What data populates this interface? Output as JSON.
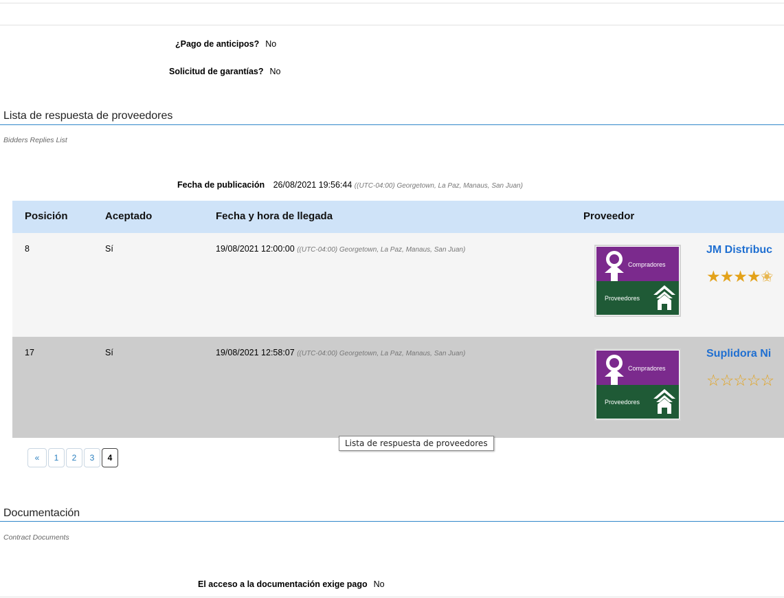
{
  "fields": {
    "advance_payment": {
      "label": "¿Pago de anticipos?",
      "value": "No"
    },
    "guarantees": {
      "label": "Solicitud de garantías?",
      "value": "No"
    }
  },
  "bidders_section": {
    "title": "Lista de respuesta de proveedores",
    "subtitle": "Bidders Replies List",
    "publication": {
      "label": "Fecha de publicación",
      "value": "26/08/2021 19:56:44",
      "timezone": "((UTC-04:00) Georgetown, La Paz, Manaus, San Juan)"
    },
    "table": {
      "headers": [
        "Posición",
        "Aceptado",
        "Fecha y hora de llegada",
        "Proveedor"
      ],
      "rows": [
        {
          "position": "8",
          "accepted": "Sí",
          "arrival": "19/08/2021 12:00:00",
          "timezone": "((UTC-04:00) Georgetown, La Paz, Manaus, San Juan)",
          "logo_top": "Compradores",
          "logo_bottom": "Proveedores",
          "vendor": "JM Distribuc",
          "rating_stars": "4.5 of 5"
        },
        {
          "position": "17",
          "accepted": "Sí",
          "arrival": "19/08/2021 12:58:07",
          "timezone": "((UTC-04:00) Georgetown, La Paz, Manaus, San Juan)",
          "logo_top": "Compradores",
          "logo_bottom": "Proveedores",
          "vendor": "Suplidora Ni",
          "rating_stars": "0 of 5"
        }
      ]
    },
    "pagination": {
      "prev": "«",
      "pages": [
        "1",
        "2",
        "3",
        "4"
      ],
      "current": "4"
    },
    "tooltip": "Lista de respuesta de proveedores"
  },
  "documents_section": {
    "title": "Documentación",
    "subtitle": "Contract Documents",
    "payment_required": {
      "label": "El acceso a la documentación exige pago",
      "value": "No"
    }
  },
  "colors": {
    "header_bg": "#cfe3f8",
    "link": "#1f6fd1",
    "section_rule": "#2f86c9",
    "logo_purple": "#7b2a8d",
    "logo_green": "#1f5a36",
    "star": "#e3a21a"
  }
}
